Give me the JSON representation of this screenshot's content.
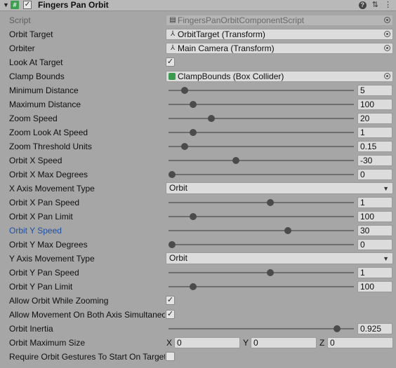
{
  "header": {
    "title": "Fingers Pan Orbit",
    "collapse_glyph": "▼",
    "script_icon": "#",
    "enabled_check": "✓",
    "help_glyph": "?",
    "presets_glyph": "⇅",
    "menu_glyph": "⋮"
  },
  "rows": {
    "script": {
      "label": "Script",
      "value": "FingersPanOrbitComponentScript"
    },
    "orbit_target": {
      "label": "Orbit Target",
      "value": "OrbitTarget (Transform)"
    },
    "orbiter": {
      "label": "Orbiter",
      "value": "Main Camera (Transform)"
    },
    "look_at_target": {
      "label": "Look At Target",
      "checked": true,
      "check": "✓"
    },
    "clamp_bounds": {
      "label": "Clamp Bounds",
      "value": "ClampBounds (Box Collider)"
    },
    "minimum_distance": {
      "label": "Minimum Distance",
      "value": "5",
      "fraction": 0.07
    },
    "maximum_distance": {
      "label": "Maximum Distance",
      "value": "100",
      "fraction": 0.12
    },
    "zoom_speed": {
      "label": "Zoom Speed",
      "value": "20",
      "fraction": 0.22
    },
    "zoom_look_at_speed": {
      "label": "Zoom Look At Speed",
      "value": "1",
      "fraction": 0.12
    },
    "zoom_threshold_units": {
      "label": "Zoom Threshold Units",
      "value": "0.15",
      "fraction": 0.07
    },
    "orbit_x_speed": {
      "label": "Orbit X Speed",
      "value": "-30",
      "fraction": 0.36
    },
    "orbit_x_max_degrees": {
      "label": "Orbit X Max Degrees",
      "value": "0",
      "fraction": 0.0
    },
    "x_axis_movement_type": {
      "label": "X Axis Movement Type",
      "value": "Orbit",
      "arrow": "▼"
    },
    "orbit_x_pan_speed": {
      "label": "Orbit X Pan Speed",
      "value": "1",
      "fraction": 0.55
    },
    "orbit_x_pan_limit": {
      "label": "Orbit X Pan Limit",
      "value": "100",
      "fraction": 0.12
    },
    "orbit_y_speed": {
      "label": "Orbit Y Speed",
      "value": "30",
      "fraction": 0.65
    },
    "orbit_y_max_degrees": {
      "label": "Orbit Y Max Degrees",
      "value": "0",
      "fraction": 0.0
    },
    "y_axis_movement_type": {
      "label": "Y Axis Movement Type",
      "value": "Orbit",
      "arrow": "▼"
    },
    "orbit_y_pan_speed": {
      "label": "Orbit Y Pan Speed",
      "value": "1",
      "fraction": 0.55
    },
    "orbit_y_pan_limit": {
      "label": "Orbit Y Pan Limit",
      "value": "100",
      "fraction": 0.12
    },
    "allow_orbit_while_zooming": {
      "label": "Allow Orbit While Zooming",
      "checked": true,
      "check": "✓"
    },
    "allow_movement_both_axis": {
      "label": "Allow Movement On Both Axis Simultaneously",
      "checked": true,
      "check": "✓"
    },
    "orbit_inertia": {
      "label": "Orbit Inertia",
      "value": "0.925",
      "fraction": 0.925
    },
    "orbit_maximum_size": {
      "label": "Orbit Maximum Size",
      "x_label": "X",
      "x": "0",
      "y_label": "Y",
      "y": "0",
      "z_label": "Z",
      "z": "0"
    },
    "require_orbit_gestures": {
      "label": "Require Orbit Gestures To Start On Target",
      "checked": false,
      "check": ""
    }
  }
}
